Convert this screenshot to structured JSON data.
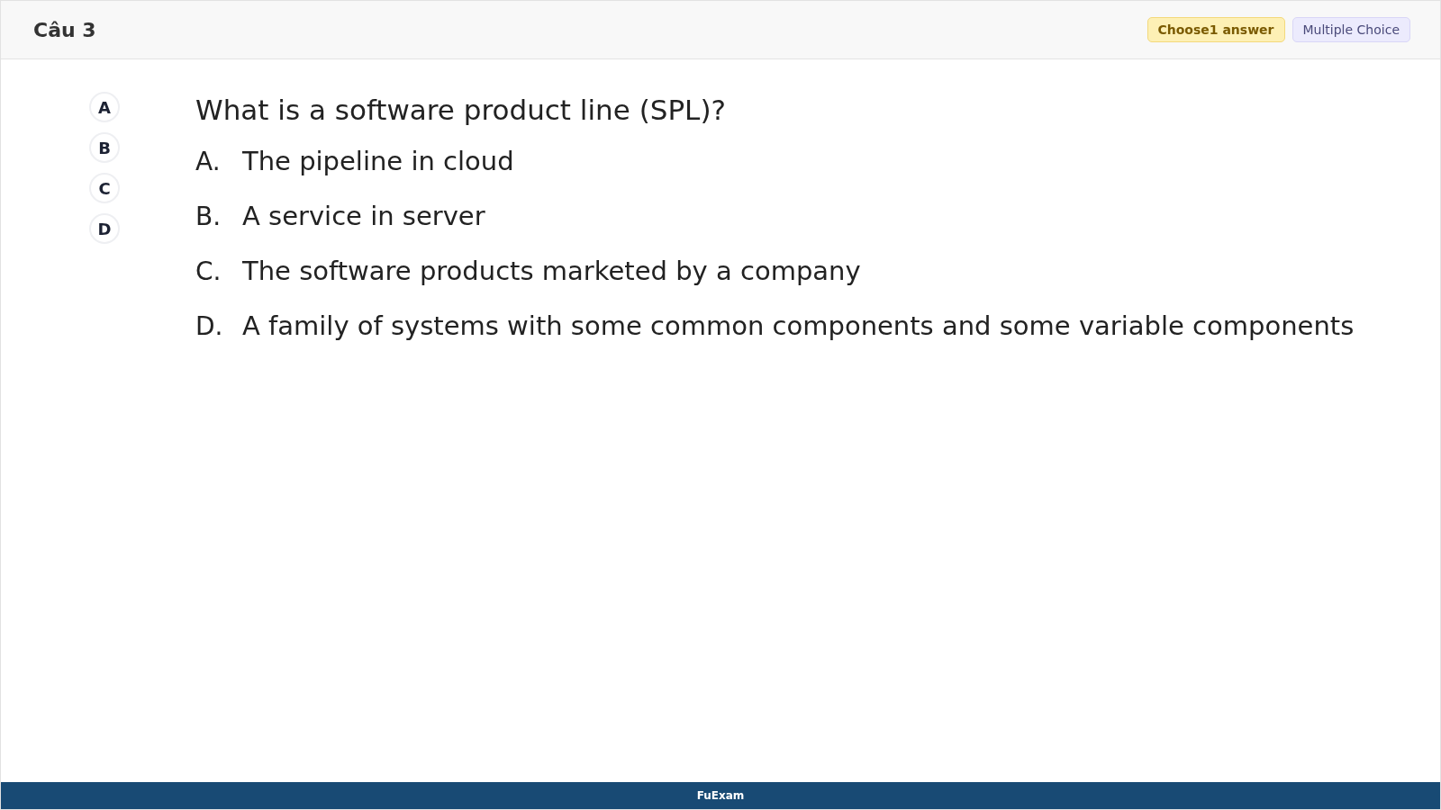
{
  "header": {
    "title": "Câu 3",
    "badges": [
      {
        "kind": "instruction",
        "label": "Choose1 answer"
      },
      {
        "kind": "type",
        "label": "Multiple Choice"
      }
    ]
  },
  "answer_buttons": [
    {
      "label": "A",
      "selected": false
    },
    {
      "label": "B",
      "selected": false
    },
    {
      "label": "C",
      "selected": false
    },
    {
      "label": "D",
      "selected": false
    }
  ],
  "question": "What is a software product line (SPL)?",
  "options": [
    {
      "letter": "A.",
      "text": "The pipeline in cloud"
    },
    {
      "letter": "B.",
      "text": "A service in server"
    },
    {
      "letter": "C.",
      "text": "The software products marketed by a company"
    },
    {
      "letter": "D.",
      "text": "A family of systems with some common components and some variable components"
    }
  ],
  "footer": "FuExam"
}
